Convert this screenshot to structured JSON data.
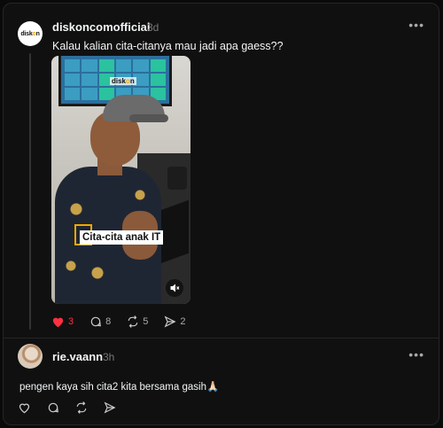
{
  "post": {
    "username": "diskoncomofficial",
    "time": "3d",
    "avatar_brand": "diskon",
    "caption": "Kalau kalian cita-citanya mau jadi apa gaess??",
    "media": {
      "overlay_text": "Cita-cita anak IT",
      "watermark": "diskon"
    },
    "actions": {
      "likes": "3",
      "comments": "8",
      "reposts": "5",
      "shares": "2"
    },
    "liked_color": "#ff3040"
  },
  "reply": {
    "username": "rie.vaann",
    "time": "3h",
    "text": "pengen kaya sih cita2 kita bersama gasih🙏🏻"
  }
}
